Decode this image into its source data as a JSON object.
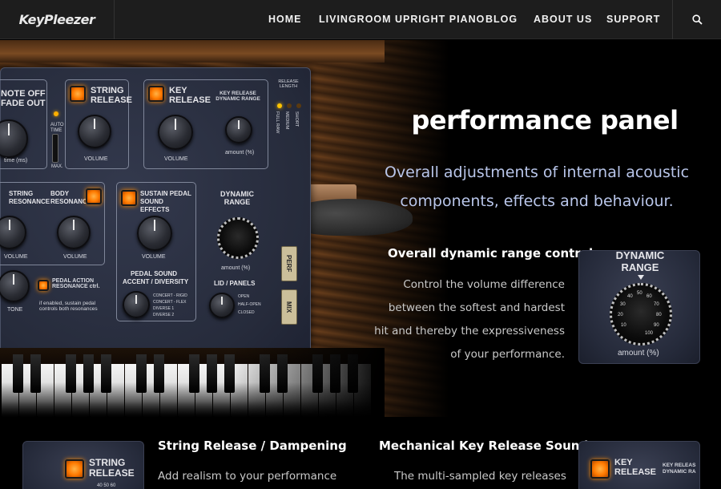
{
  "header": {
    "logo": "KeyPleezer",
    "nav": [
      "HOME",
      "LIVINGROOM UPRIGHT PIANO",
      "BLOG",
      "ABOUT US",
      "SUPPORT"
    ]
  },
  "hero": {
    "title": "performance panel",
    "lead": "Overall adjustments of internal acoustic components, effects and behaviour.",
    "feature_title": "Overall dynamic range control",
    "feature_text": "Control the volume difference between the softest and hardest hit and thereby the expressiveness of your performance."
  },
  "panel": {
    "note_off": "NOTE OFF",
    "fade_out": "FADE OUT",
    "time_ms": "time (ms)",
    "auto_time": "AUTO TIME",
    "max": "MAX.",
    "string_release": "STRING RELEASE",
    "volume": "VOLUME",
    "key_release": "KEY RELEASE",
    "key_release_dynamic_range": "KEY RELEASE DYNAMIC RANGE",
    "amount_pct": "amount (%)",
    "release_length": "RELEASE LENGTH",
    "full_raw": "FULL RAW",
    "medium": "MEDIUM",
    "short": "SHORT",
    "string_resonance": "STRING RESONANCE",
    "body_resonance": "BODY RESONANCE",
    "sustain_pedal_sound_effects": "SUSTAIN PEDAL SOUND EFFECTS",
    "dynamic_range": "DYNAMIC RANGE",
    "pedal_action_resonance": "PEDAL ACTION RESONANCE ctrl.",
    "pedal_note": "if enabled, sustain pedal controls both resonances",
    "tone": "TONE",
    "pedal_sound": "PEDAL SOUND",
    "accent_diversity": "ACCENT / DIVERSITY",
    "lid_panels": "LID / PANELS",
    "pedal_options": [
      "CONCERT - RIGID",
      "CONCERT - FLEX",
      "DIVERSE 1",
      "DIVERSE 2"
    ],
    "lid_options": [
      "OPEN",
      "HALF-OPEN",
      "CLOSED"
    ],
    "perf": "PERF",
    "mix": "MIX"
  },
  "thumb": {
    "title": "DYNAMIC RANGE",
    "amount": "amount (%)",
    "dial_ticks": [
      "10",
      "20",
      "30",
      "40",
      "50",
      "60",
      "70",
      "80",
      "90",
      "100"
    ]
  },
  "below": {
    "col1_title": "String Release / Dampening",
    "col1_text": "Add realism to your performance",
    "col2_title": "Mechanical Key Release Sounds",
    "col2_text": "The multi-sampled key releases",
    "thumb_left_label": "STRING RELEASE",
    "thumb_right_label1": "KEY RELEASE",
    "thumb_right_label2": "KEY RELEAS DYNAMIC RA",
    "knob_scale": "40 50 60"
  }
}
